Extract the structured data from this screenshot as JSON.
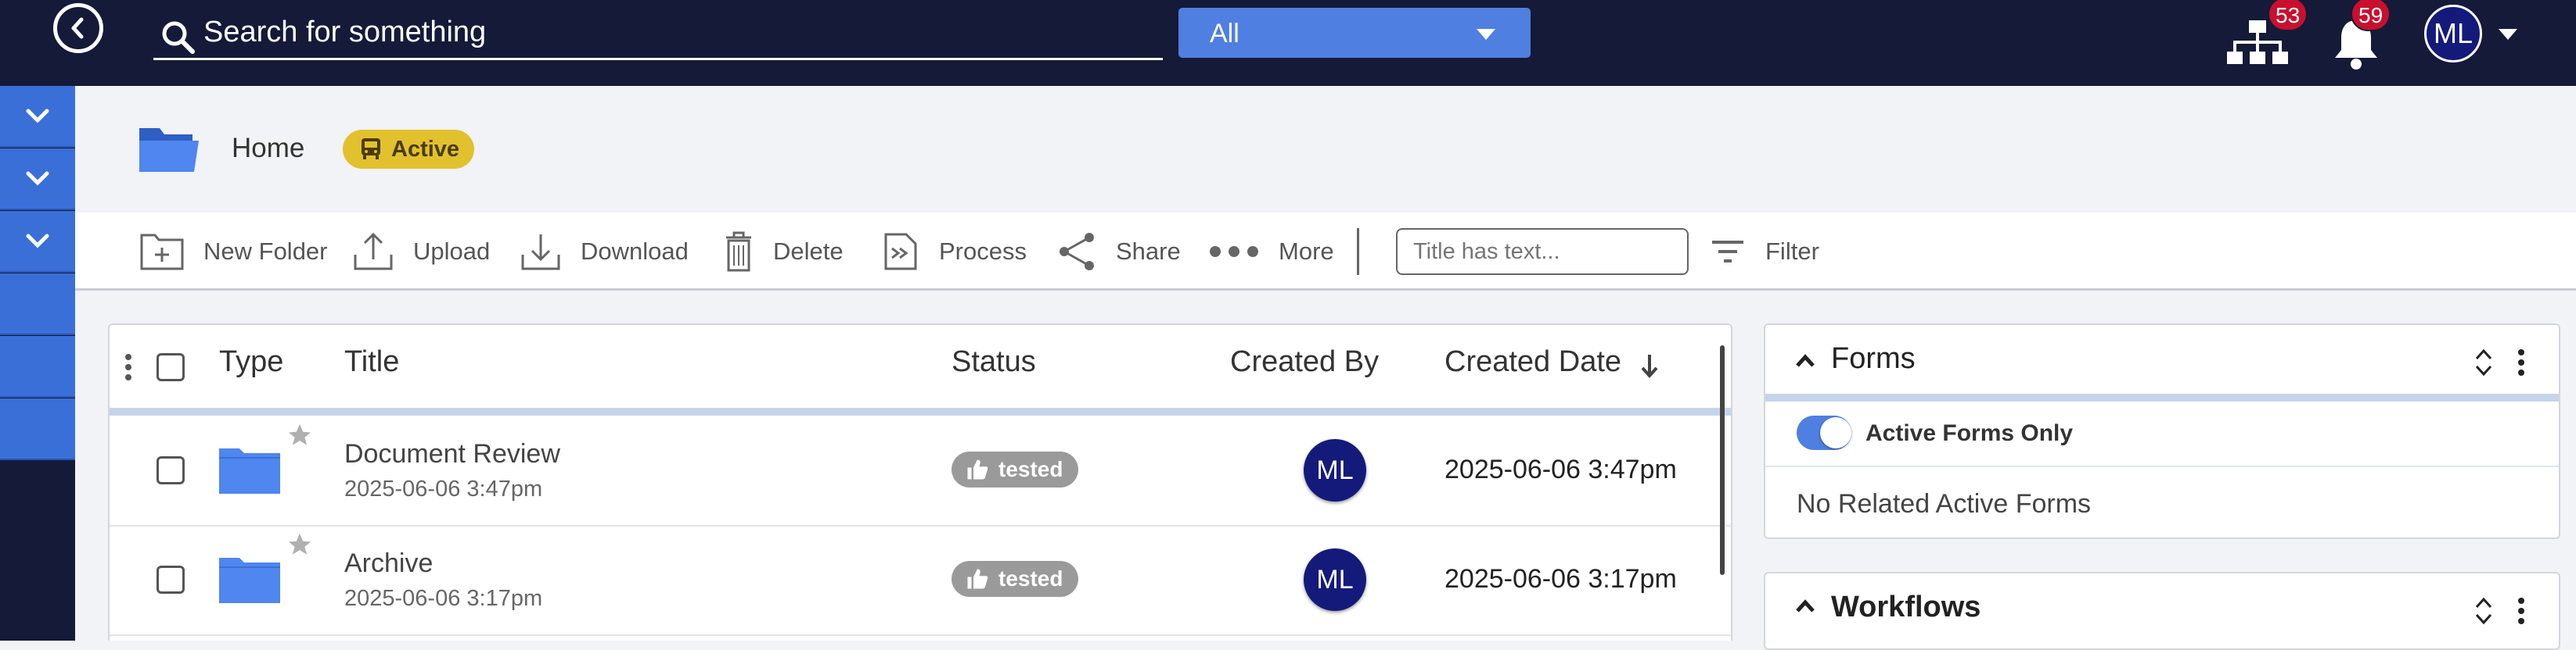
{
  "topbar": {
    "search_placeholder": "Search for something",
    "scope_value": "All",
    "org_badge_count": "53",
    "notif_badge_count": "59",
    "user_initials": "ML"
  },
  "breadcrumb": {
    "home_label": "Home",
    "status_label": "Active"
  },
  "toolbar": {
    "new_folder": "New Folder",
    "upload": "Upload",
    "download": "Download",
    "delete": "Delete",
    "process": "Process",
    "share": "Share",
    "more": "More",
    "filter_placeholder": "Title has text...",
    "filter": "Filter"
  },
  "table": {
    "columns": {
      "type": "Type",
      "title": "Title",
      "status": "Status",
      "created_by": "Created By",
      "created_date": "Created Date"
    },
    "rows": [
      {
        "title": "Document Review",
        "subtitle": "2025-06-06 3:47pm",
        "status": "tested",
        "created_by": "ML",
        "created_date": "2025-06-06 3:47pm"
      },
      {
        "title": "Archive",
        "subtitle": "2025-06-06 3:17pm",
        "status": "tested",
        "created_by": "ML",
        "created_date": "2025-06-06 3:17pm"
      }
    ]
  },
  "forms_panel": {
    "title": "Forms",
    "toggle_label": "Active Forms Only",
    "toggle_on": true,
    "empty_text": "No Related Active Forms"
  },
  "workflows_panel": {
    "title": "Workflows"
  },
  "colors": {
    "topbar": "#141a38",
    "accent": "#4f7fe0",
    "badge": "#c8102e",
    "active_pill": "#e2c12f",
    "folder": "#4f86f0"
  }
}
